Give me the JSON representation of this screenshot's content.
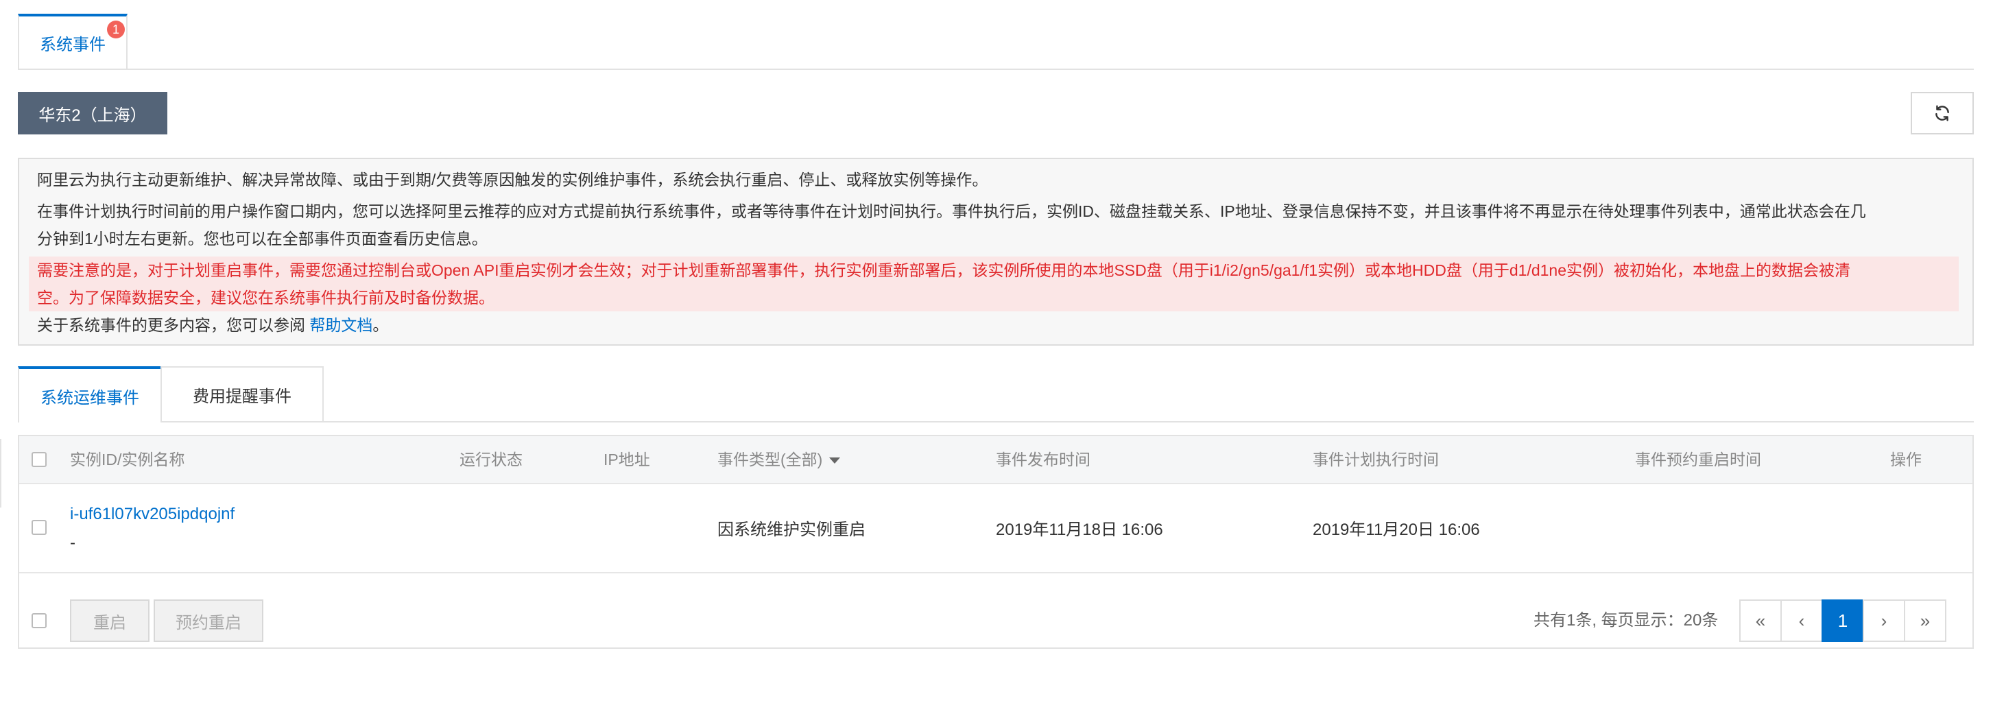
{
  "top_tab": {
    "label": "系统事件",
    "badge": "1"
  },
  "region": {
    "label": "华东2（上海）"
  },
  "refresh": {
    "icon": "refresh-icon"
  },
  "notice": {
    "line1": "阿里云为执行主动更新维护、解决异常故障、或由于到期/欠费等原因触发的实例维护事件，系统会执行重启、停止、或释放实例等操作。",
    "line2a": "在事件计划执行时间前的用户操作窗口期内，您可以选择阿里云推荐的应对方式提前执行系统事件，或者等待事件在计划时间执行。事件执行后，实例ID、磁盘挂载关系、IP地址、登录信息保持不变，并且该事件将不再显示在待处理事件列表中，通常此状态会在几",
    "line2b": "分钟到1小时左右更新。您也可以在全部事件页面查看历史信息。",
    "warning_a": "需要注意的是，对于计划重启事件，需要您通过控制台或Open API重启实例才会生效；对于计划重新部署事件，执行实例重新部署后，该实例所使用的本地SSD盘（用于i1/i2/gn5/ga1/f1实例）或本地HDD盘（用于d1/d1ne实例）被初始化，本地盘上的数据会被清",
    "warning_b": "空。为了保障数据安全，建议您在系统事件执行前及时备份数据。",
    "more_prefix": "关于系统事件的更多内容，您可以参阅 ",
    "more_link": "帮助文档",
    "more_suffix": "。"
  },
  "sub_tabs": [
    {
      "label": "系统运维事件",
      "active": true
    },
    {
      "label": "费用提醒事件",
      "active": false
    }
  ],
  "table": {
    "columns": [
      "实例ID/实例名称",
      "运行状态",
      "IP地址",
      "事件类型(全部)",
      "事件发布时间",
      "事件计划执行时间",
      "事件预约重启时间",
      "操作"
    ],
    "rows": [
      {
        "instance_id": "i-uf61l07kv205ipdqojnf",
        "instance_name": "-",
        "status": "",
        "ip": "",
        "event_type": "因系统维护实例重启",
        "publish_time": "2019年11月18日 16:06",
        "plan_time": "2019年11月20日 16:06",
        "reserve_time": "",
        "action": ""
      }
    ]
  },
  "footer": {
    "restart_label": "重启",
    "schedule_restart_label": "预约重启",
    "page_info": "共有1条, 每页显示：20条",
    "pager": {
      "first": "«",
      "prev": "‹",
      "current": "1",
      "next": "›",
      "last": "»"
    }
  },
  "colors": {
    "accent": "#0070cc",
    "region_bg": "#546478",
    "warning_text": "#e0292c",
    "warning_bg": "#fbe6e6",
    "badge": "#f2625a"
  }
}
